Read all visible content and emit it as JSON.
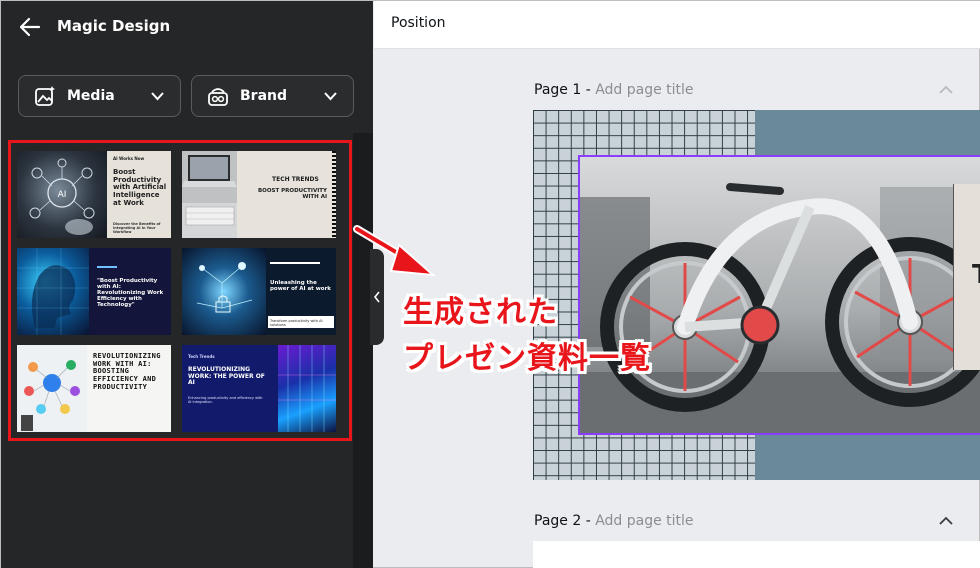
{
  "panel": {
    "title": "Magic Design",
    "filters": [
      {
        "label": "Media"
      },
      {
        "label": "Brand"
      }
    ],
    "templates": [
      {
        "kicker": "AI Works Now",
        "title": "Boost Productivity with Artificial Intelligence at Work",
        "sub": "Discover the Benefits of Integrating AI in Your Workflow"
      },
      {
        "kicker": "TECH TRENDS",
        "title": "BOOST PRODUCTIVITY WITH AI"
      },
      {
        "kicker": "",
        "title": "\"Boost Productivity with AI: Revolutionizing Work Efficiency with Technology\""
      },
      {
        "title": "Unleashing the power of AI at work",
        "sub": "Transform productivity with AI solutions"
      },
      {
        "title": "REVOLUTIONIZING WORK WITH AI: BOOSTING EFFICIENCY AND PRODUCTIVITY"
      },
      {
        "kicker": "Tech Trends",
        "title": "REVOLUTIONIZING WORK: THE POWER OF AI",
        "sub": "Enhancing productivity and efficiency with AI integration."
      }
    ]
  },
  "editor": {
    "topbar_title": "Position",
    "pages": [
      {
        "number": "Page 1 - ",
        "title_placeholder": "Add page title"
      },
      {
        "number": "Page 2 - ",
        "title_placeholder": "Add page title"
      }
    ],
    "page1_visible_text": "T"
  },
  "annotation": {
    "line1": "生成された",
    "line2": "プレゼン資料一覧",
    "color": "#e8151b"
  },
  "colors": {
    "panel_bg": "#252627",
    "selection": "#8b3dff",
    "highlight": "#e8151b"
  }
}
